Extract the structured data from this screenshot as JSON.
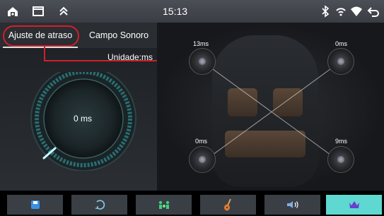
{
  "status": {
    "time": "15:13",
    "icons": [
      "home-icon",
      "window-icon",
      "chevron-up-icon",
      "bluetooth-icon",
      "signal-icon",
      "wifi-icon",
      "back-icon"
    ]
  },
  "tabs": [
    {
      "label": "Ajuste de atraso",
      "active": true
    },
    {
      "label": "Campo Sonoro",
      "active": false
    }
  ],
  "left": {
    "unit_label": "Unidade:ms",
    "dial_value": "0 ms"
  },
  "speakers": {
    "front_left": "13ms",
    "front_right": "0ms",
    "rear_left": "0ms",
    "rear_right": "9ms"
  },
  "toolbar": {
    "buttons": [
      "save-icon",
      "reset-icon",
      "listening-position-icon",
      "guitar-icon",
      "speaker-icon",
      "crown-icon"
    ],
    "active_index": 5
  },
  "colors": {
    "accent": "#5ed8d0",
    "callout": "#d0202b"
  }
}
